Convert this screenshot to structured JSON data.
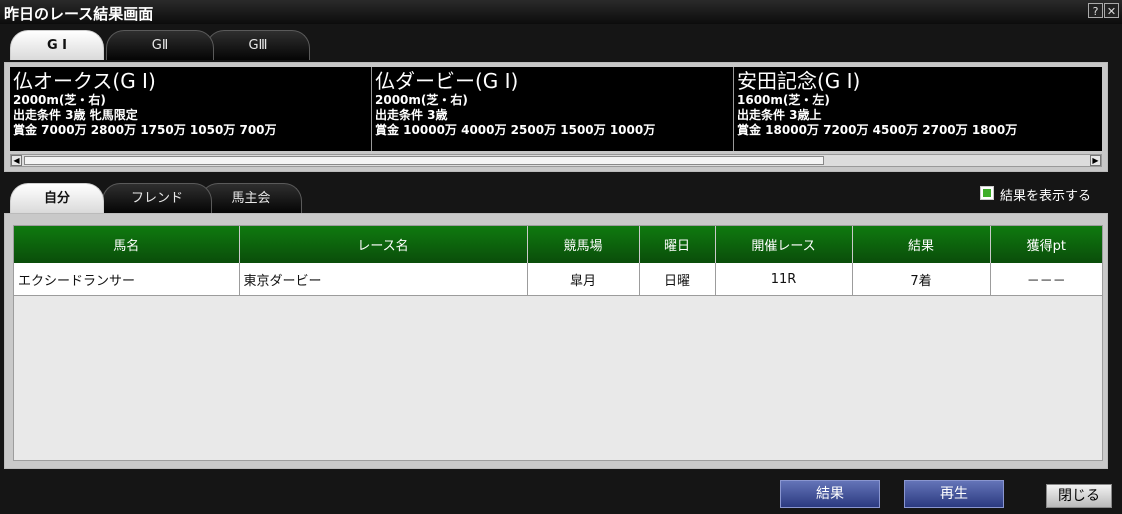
{
  "window": {
    "title": "昨日のレース結果画面",
    "help_label": "?",
    "close_label": "✕"
  },
  "grade_tabs": [
    {
      "label": "G I",
      "active": true
    },
    {
      "label": "GⅡ",
      "active": false
    },
    {
      "label": "GⅢ",
      "active": false
    }
  ],
  "races": [
    {
      "name": "仏オークス(G I)",
      "distance": "2000m(芝・右)",
      "conditions": "出走条件 3歳 牝馬限定",
      "prize": "賞金 7000万 2800万 1750万 1050万 700万"
    },
    {
      "name": "仏ダービー(G I)",
      "distance": "2000m(芝・右)",
      "conditions": "出走条件 3歳",
      "prize": "賞金 10000万 4000万 2500万 1500万 1000万"
    },
    {
      "name": "安田記念(G I)",
      "distance": "1600m(芝・左)",
      "conditions": "出走条件 3歳上",
      "prize": "賞金 18000万 7200万 4500万 2700万 1800万"
    }
  ],
  "owner_tabs": [
    {
      "label": "自分",
      "active": true
    },
    {
      "label": "フレンド",
      "active": false
    },
    {
      "label": "馬主会",
      "active": false
    }
  ],
  "show_results": {
    "label": "結果を表示する",
    "checked": true,
    "check_color": "#3fae2a"
  },
  "table": {
    "headers": [
      "馬名",
      "レース名",
      "競馬場",
      "曜日",
      "開催レース",
      "結果",
      "獲得pt"
    ],
    "rows": [
      [
        "エクシードランサー",
        "東京ダービー",
        "皐月",
        "日曜",
        "11R",
        "7着",
        "－－－"
      ]
    ]
  },
  "buttons": {
    "result": "結果",
    "replay": "再生",
    "close": "閉じる"
  },
  "colors": {
    "header_green": "#0f7a0f",
    "button_blue": "#4a5aa0"
  }
}
